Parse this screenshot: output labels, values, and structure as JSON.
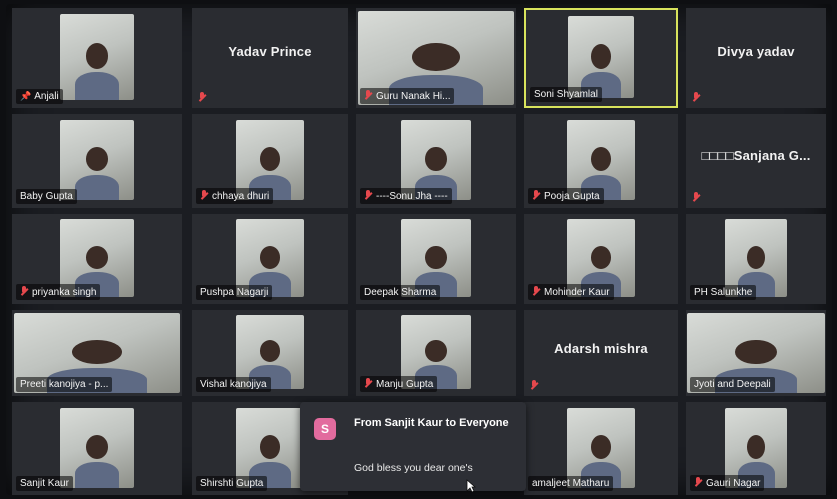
{
  "tiles": [
    {
      "name": "Anjali",
      "pinned": true,
      "muted": false,
      "video": true
    },
    {
      "name": "Yadav Prince",
      "muted": true,
      "video": false
    },
    {
      "name": "Guru Nanak Hi...",
      "muted": true,
      "video": true,
      "wide": true
    },
    {
      "name": "Soni Shyamlal",
      "muted": false,
      "video": true,
      "active": true
    },
    {
      "name": "Divya yadav",
      "muted": true,
      "video": false
    },
    {
      "name": "Baby Gupta",
      "muted": false,
      "video": true
    },
    {
      "name": "chhaya dhuri",
      "muted": true,
      "video": true
    },
    {
      "name": "----Sonu Jha ----",
      "muted": true,
      "video": true
    },
    {
      "name": "Pooja Gupta",
      "muted": true,
      "video": true
    },
    {
      "name": "□□□□Sanjana G...",
      "muted": true,
      "video": false
    },
    {
      "name": "priyanka singh",
      "muted": true,
      "video": true
    },
    {
      "name": "Pushpa Nagarji",
      "muted": false,
      "video": true
    },
    {
      "name": "Deepak Sharma",
      "muted": false,
      "video": true
    },
    {
      "name": "Mohinder Kaur",
      "muted": true,
      "video": true
    },
    {
      "name": "PH Salunkhe",
      "muted": false,
      "video": true
    },
    {
      "name": "Preeti  kanojiya - p...",
      "muted": false,
      "video": true,
      "wide": true
    },
    {
      "name": "Vishal kanojiya",
      "muted": false,
      "video": true
    },
    {
      "name": "Manju Gupta",
      "muted": true,
      "video": true
    },
    {
      "name": "Adarsh mishra",
      "muted": true,
      "video": false
    },
    {
      "name": "Jyoti and Deepali",
      "muted": false,
      "video": true,
      "wide": true
    },
    {
      "name": "Sanjit Kaur",
      "muted": false,
      "video": true
    },
    {
      "name": "Shirshti Gupta",
      "muted": false,
      "video": true
    },
    {
      "name": "",
      "muted": false,
      "video": false,
      "hidden": true
    },
    {
      "name": "amaljeet Matharu",
      "muted": false,
      "video": true
    },
    {
      "name": "Gauri Nagar",
      "muted": true,
      "video": true
    }
  ],
  "chat": {
    "avatar_letter": "S",
    "from": "From Sanjit Kaur to Everyone",
    "message": "God bless you dear one's"
  },
  "colors": {
    "active_border": "#d8e35c",
    "muted_icon": "#e5484d",
    "chat_avatar": "#e26b9e"
  },
  "icons": {
    "pin": "pin-icon",
    "muted": "mic-muted-icon",
    "cursor": "mouse-cursor-icon"
  }
}
